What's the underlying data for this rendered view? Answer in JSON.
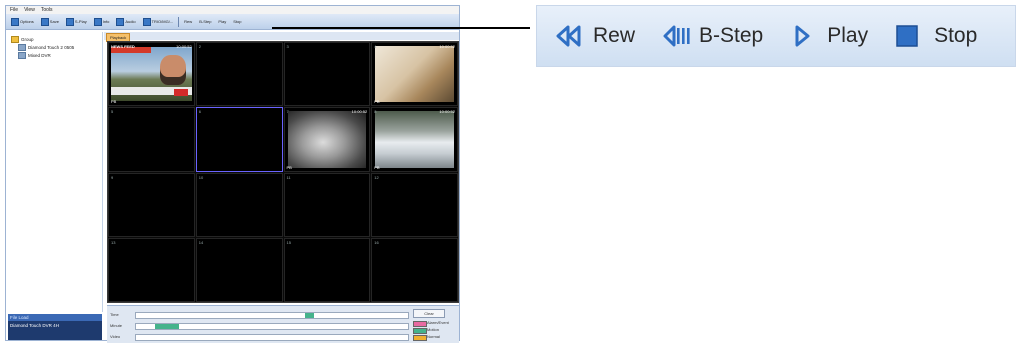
{
  "app": {
    "menu": [
      "File",
      "View",
      "Tools"
    ],
    "toolbar": [
      {
        "label": "Options",
        "icon": "options-icon"
      },
      {
        "label": "Save",
        "icon": "save-icon"
      },
      {
        "label": "S-Play",
        "icon": "splay-icon"
      },
      {
        "label": "Info",
        "icon": "info-icon"
      },
      {
        "label": "Audio",
        "icon": "audio-icon"
      },
      {
        "label": "TRIO/MG/...",
        "icon": "trio-icon"
      }
    ],
    "tree": {
      "root": "Group",
      "items": [
        "Diamond Touch 2 0505",
        "Mixed DVR"
      ]
    },
    "device_panel": {
      "header": "File Load",
      "device": "Diamond Touch DVR 4H"
    },
    "tab": "Playback",
    "cells": [
      {
        "num": "1",
        "ts": "10:00:52",
        "feed": "news",
        "label": "NEWS FEED",
        "pb": "PB"
      },
      {
        "num": "2"
      },
      {
        "num": "3"
      },
      {
        "num": "4",
        "ts": "10:00:52",
        "feed": "wall",
        "pb": "PB"
      },
      {
        "num": "5"
      },
      {
        "num": "6"
      },
      {
        "num": "7",
        "ts": "10:00:52",
        "feed": "room",
        "pb": "PB"
      },
      {
        "num": "8",
        "ts": "10:00:52",
        "feed": "cars",
        "pb": "PB"
      },
      {
        "num": "9"
      },
      {
        "num": "10"
      },
      {
        "num": "11"
      },
      {
        "num": "12"
      },
      {
        "num": "13"
      },
      {
        "num": "14"
      },
      {
        "num": "15"
      },
      {
        "num": "16"
      }
    ],
    "timeline": {
      "rows": [
        "Time",
        "Minute",
        "Video"
      ],
      "clear_label": "Clear",
      "legend": [
        {
          "label": "Alarm/Event",
          "color": "#e86aa2"
        },
        {
          "label": "Motion",
          "color": "#45b38c"
        },
        {
          "label": "Normal",
          "color": "#f0b030"
        }
      ]
    }
  },
  "playback_controls": [
    {
      "label": "Rew",
      "icon": "rewind-icon"
    },
    {
      "label": "B-Step",
      "icon": "back-step-icon"
    },
    {
      "label": "Play",
      "icon": "play-icon"
    },
    {
      "label": "Stop",
      "icon": "stop-icon"
    }
  ],
  "colors": {
    "control_icon": "#2f6fc4",
    "highlight": "#6a63ff"
  }
}
